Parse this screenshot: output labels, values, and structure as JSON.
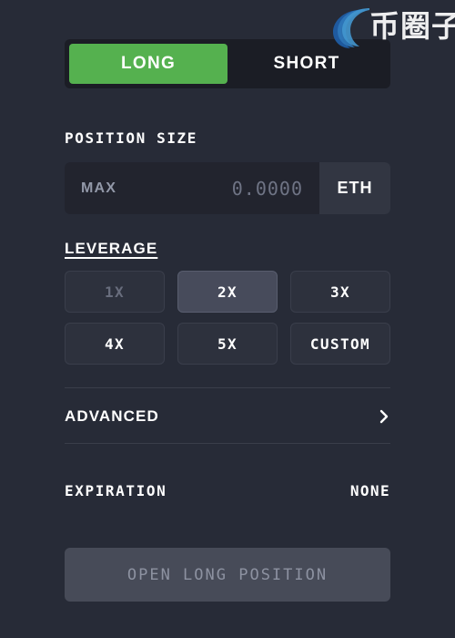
{
  "watermark": {
    "text": "币圈子",
    "mark_icon": "c-swirl-logo-icon",
    "color": "#2f7dc4"
  },
  "side_toggle": {
    "long_label": "LONG",
    "short_label": "SHORT",
    "selected": "LONG",
    "active_color": "#55b14f",
    "track_color": "#1b1d25"
  },
  "position_size": {
    "label": "POSITION SIZE",
    "max_label": "MAX",
    "value": "0.0000",
    "unit": "ETH"
  },
  "leverage": {
    "label": "LEVERAGE",
    "selected": "2X",
    "options": [
      {
        "label": "1X",
        "state": "disabled"
      },
      {
        "label": "2X",
        "state": "selected"
      },
      {
        "label": "3X",
        "state": "default"
      },
      {
        "label": "4X",
        "state": "default"
      },
      {
        "label": "5X",
        "state": "default"
      },
      {
        "label": "CUSTOM",
        "state": "default"
      }
    ]
  },
  "advanced": {
    "label": "ADVANCED",
    "chevron_icon": "chevron-right-icon"
  },
  "expiration": {
    "label": "EXPIRATION",
    "value": "NONE"
  },
  "submit": {
    "label": "OPEN LONG POSITION",
    "enabled": false
  }
}
